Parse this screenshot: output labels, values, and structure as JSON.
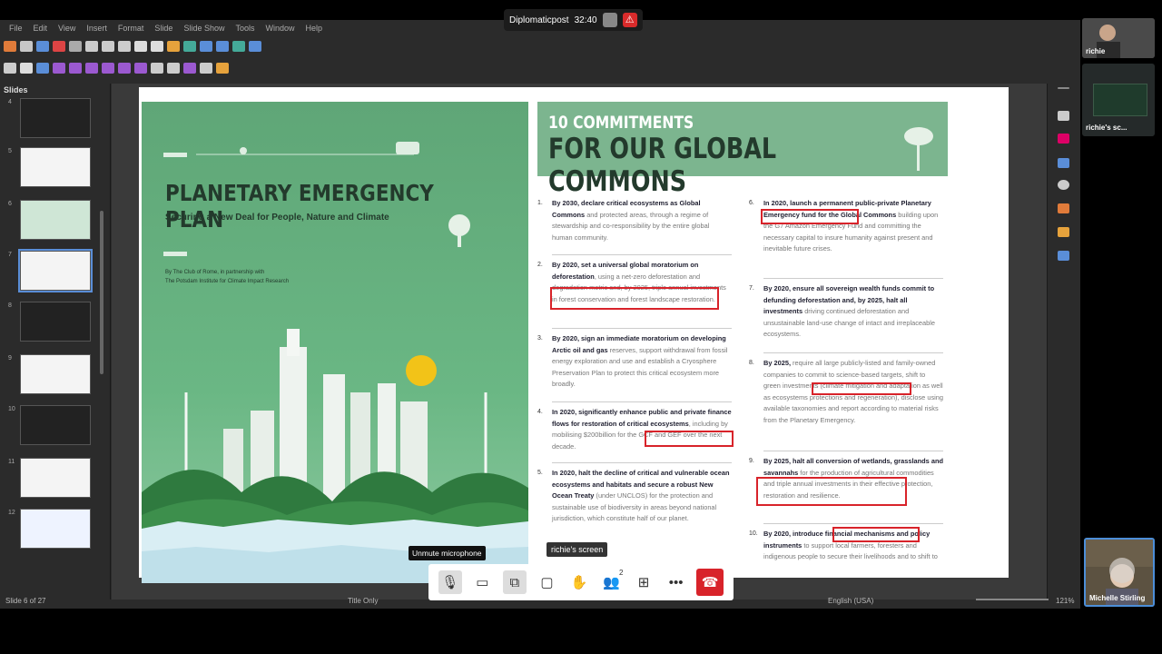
{
  "app": {
    "menu": [
      "File",
      "Edit",
      "View",
      "Insert",
      "Format",
      "Slide",
      "Slide Show",
      "Tools",
      "Window",
      "Help"
    ],
    "panel_label": "Slides"
  },
  "meeting": {
    "presenter_name": "Diplomaticpost",
    "timer": "32:40",
    "tooltip": "Unmute microphone",
    "screen_label": "richie's screen",
    "participant_count": "2",
    "participants": [
      {
        "name": "richie"
      },
      {
        "name": "richie's sc..."
      },
      {
        "name": "Michelle Stirling"
      }
    ]
  },
  "slides": {
    "thumb_numbers": [
      "4",
      "5",
      "6",
      "7",
      "8",
      "9",
      "10",
      "11",
      "12"
    ],
    "selected_index": 3
  },
  "poster": {
    "title": "PLANETARY EMERGENCY PLAN",
    "subtitle": "Securing a New Deal for People, Nature and Climate",
    "credit_line1": "By The Club of Rome, in partnership with",
    "credit_line2": "The Potsdam Institute for Climate Impact Research"
  },
  "document": {
    "heading_small": "10 COMMITMENTS",
    "heading_large": "FOR OUR GLOBAL COMMONS",
    "commitments": [
      {
        "num": "1.",
        "bold": "By 2030, declare critical ecosystems as Global Commons",
        "rest": " and protected areas, through a regime of stewardship and co-responsibility by the entire global human community."
      },
      {
        "num": "2.",
        "bold": "By 2020, set a universal global moratorium on deforestation",
        "rest": ", using a net-zero deforestation and degradation metric and, by 2025, triple annual investments in forest conservation and forest landscape restoration."
      },
      {
        "num": "3.",
        "bold": "By 2020, sign an immediate moratorium on developing Arctic oil and gas",
        "rest": " reserves, support withdrawal from fossil energy exploration and use and establish a Cryosphere Preservation Plan to protect this critical ecosystem more broadly."
      },
      {
        "num": "4.",
        "bold": "In 2020, significantly enhance public and private finance flows for restoration of critical ecosystems",
        "rest": ", including by mobilising $200billion for the GCF and GEF over the next decade."
      },
      {
        "num": "5.",
        "bold": "In 2020, halt the decline of critical and vulnerable ocean ecosystems and habitats and secure a robust New Ocean Treaty",
        "rest": " (under UNCLOS) for the protection and sustainable use of biodiversity in areas beyond national jurisdiction, which constitute half of our planet."
      },
      {
        "num": "6.",
        "bold": "In 2020, launch a permanent public-private Planetary Emergency fund for the Global Commons",
        "rest": " building upon the G7 Amazon Emergency Fund and committing the necessary capital to insure humanity against present and inevitable future crises."
      },
      {
        "num": "7.",
        "bold": "By 2020, ensure all sovereign wealth funds commit to defunding deforestation and, by 2025, halt all investments",
        "rest": " driving continued deforestation and unsustainable land-use change of intact and irreplaceable ecosystems."
      },
      {
        "num": "8.",
        "bold": "By 2025,",
        "rest": " require all large publicly-listed and family-owned companies to commit to science-based targets, shift to green investments (climate mitigation and adaptation as well as ecosystems protections and regeneration), disclose using available taxonomies and report according to material risks from the Planetary Emergency."
      },
      {
        "num": "9.",
        "bold": "By 2025, halt all conversion of wetlands, grasslands and savannahs",
        "rest": " for the production of agricultural commodities and triple annual investments in their effective protection, restoration and resilience."
      },
      {
        "num": "10.",
        "bold": "By 2020, introduce financial mechanisms and policy instruments",
        "rest": " to support local farmers, foresters and indigenous people to secure their livelihoods and to shift to"
      }
    ]
  },
  "status": {
    "slide_counter": "Slide 6 of 27",
    "layout": "Title Only",
    "language": "English (USA)",
    "zoom": "121%"
  },
  "colors": {
    "accent_red": "#d8232a",
    "poster_green": "#6ab784",
    "header_green": "#7cb58f"
  }
}
